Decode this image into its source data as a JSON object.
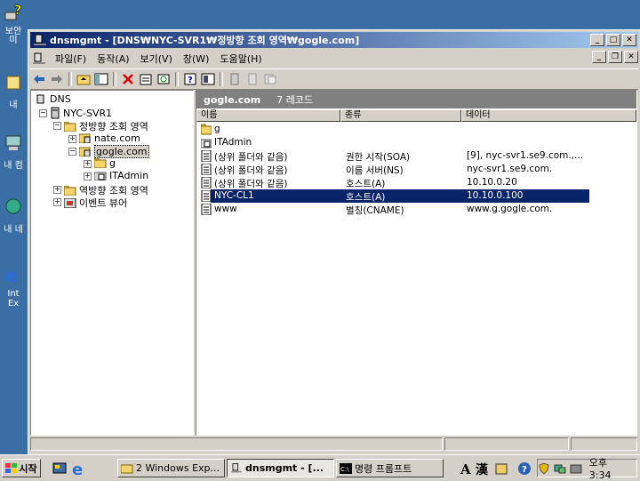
{
  "desktop": {
    "icons": [
      {
        "label": "보안 미",
        "icon": "help-computer-icon"
      },
      {
        "label": "내",
        "icon": "documents-icon"
      },
      {
        "label": "내 컴",
        "icon": "my-computer-icon"
      },
      {
        "label": "내 네",
        "icon": "network-icon"
      },
      {
        "label": "Int Ex",
        "icon": "ie-icon"
      }
    ]
  },
  "window": {
    "title": "dnsmgmt - [DNS₩NYC-SVR1₩정방향 조회 영역₩gogle.com]",
    "title_color": "#0a246a",
    "menu": [
      "파일(F)",
      "동작(A)",
      "보기(V)",
      "창(W)",
      "도움말(H)"
    ],
    "toolbar_icons": [
      "back-icon",
      "forward-icon",
      "up-folder-icon",
      "show-tree-icon",
      "delete-icon",
      "properties-icon",
      "refresh-icon",
      "help-icon",
      "export-icon",
      "record-icon",
      "record2-icon",
      "record3-icon"
    ]
  },
  "tree": {
    "root": "DNS",
    "server": "NYC-SVR1",
    "forward": "정방향 조회 영역",
    "zone1": "nate.com",
    "zone2": "gogle.com",
    "sub1": "g",
    "sub2": "ITAdmin",
    "reverse": "역방향 조회 영역",
    "events": "이벤트 뷰어"
  },
  "details": {
    "zone_title": "gogle.com",
    "record_count": "7 레코드",
    "columns": [
      "이름",
      "종류",
      "데이터"
    ],
    "rows": [
      {
        "name": "g",
        "type": "",
        "data": "",
        "icon": "folder-icon"
      },
      {
        "name": "ITAdmin",
        "type": "",
        "data": "",
        "icon": "delegated-folder-icon"
      },
      {
        "name": "(상위 폴더와 같음)",
        "type": "권한 시작(SOA)",
        "data": "[9], nyc-svr1.se9.com.,...",
        "icon": "record-icon"
      },
      {
        "name": "(상위 폴더와 같음)",
        "type": "이름 서버(NS)",
        "data": "nyc-svr1.se9.com.",
        "icon": "record-icon"
      },
      {
        "name": "(상위 폴더와 같음)",
        "type": "호스트(A)",
        "data": "10.10.0.20",
        "icon": "record-icon"
      },
      {
        "name": "NYC-CL1",
        "type": "호스트(A)",
        "data": "10.10.0.100",
        "icon": "record-icon",
        "selected": true
      },
      {
        "name": "www",
        "type": "별칭(CNAME)",
        "data": "www.g.gogle.com.",
        "icon": "record-icon"
      }
    ]
  },
  "taskbar": {
    "start": "시작",
    "tasks": [
      "2 Windows Exp...",
      "dnsmgmt - [...",
      "명령 프롬프트"
    ],
    "clock": "오후 3:34"
  }
}
